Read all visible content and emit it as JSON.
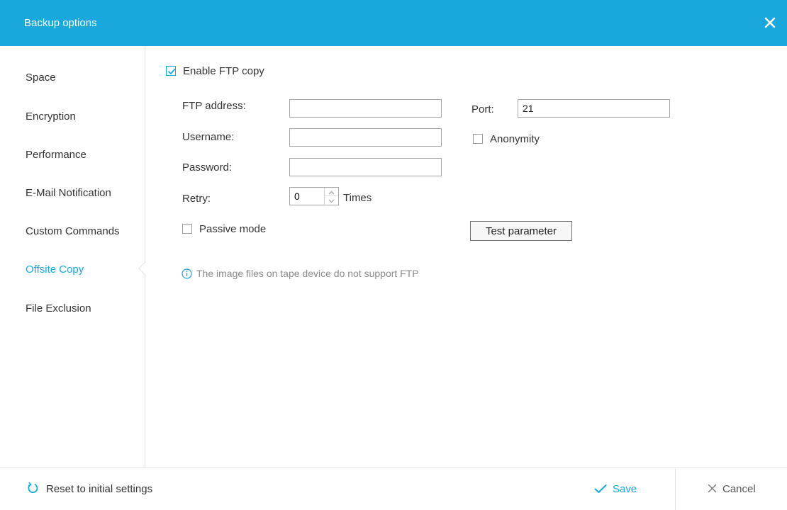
{
  "window": {
    "title": "Backup options",
    "close_icon": "close-icon"
  },
  "colors": {
    "accent": "#1aa7dc",
    "text": "#333333",
    "muted": "#8a8a8a"
  },
  "sidebar": {
    "items": [
      {
        "label": "Space",
        "active": false
      },
      {
        "label": "Encryption",
        "active": false
      },
      {
        "label": "Performance",
        "active": false
      },
      {
        "label": "E-Mail Notification",
        "active": false
      },
      {
        "label": "Custom Commands",
        "active": false
      },
      {
        "label": "Offsite Copy",
        "active": true
      },
      {
        "label": "File Exclusion",
        "active": false
      }
    ]
  },
  "ftp": {
    "enable_label": "Enable FTP copy",
    "enable_checked": true,
    "address_label": "FTP address:",
    "address_value": "",
    "port_label": "Port:",
    "port_value": "21",
    "username_label": "Username:",
    "username_value": "",
    "anonymity_label": "Anonymity",
    "anonymity_checked": false,
    "password_label": "Password:",
    "password_value": "",
    "retry_label": "Retry:",
    "retry_value": "0",
    "retry_unit": "Times",
    "passive_label": "Passive mode",
    "passive_checked": false,
    "test_button": "Test parameter",
    "info_text": "The image files on tape device do not support FTP"
  },
  "footer": {
    "reset_label": "Reset to initial settings",
    "save_label": "Save",
    "cancel_label": "Cancel"
  }
}
